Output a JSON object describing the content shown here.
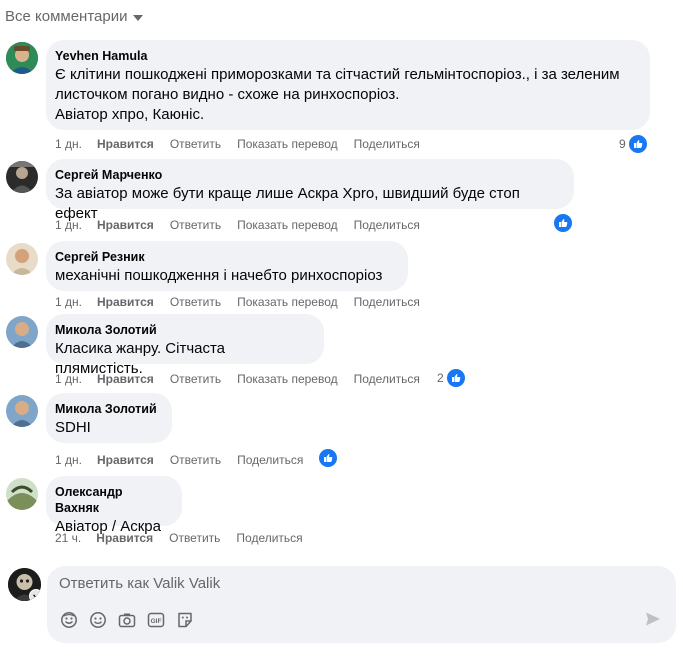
{
  "filter": {
    "label": "Все комментарии"
  },
  "comments": [
    {
      "author": "Yevhen Hamula",
      "lines": [
        "Є клітини пошкоджені приморозками та сітчастий гельмінтоспоріоз., і за зеленим",
        "листочком погано видно - схоже на ринхоспоріоз.",
        "Авіатор хпро, Каюніс."
      ],
      "time": "1 дн.",
      "like": "Нравится",
      "reply": "Ответить",
      "translate": "Показать перевод",
      "share": "Поделиться",
      "reactions": "9"
    },
    {
      "author": "Сергей Марченко",
      "lines": [
        "За авіатор може бути краще лише Аскра Xpro, швидший буде стоп ефект"
      ],
      "time": "1 дн.",
      "like": "Нравится",
      "reply": "Ответить",
      "translate": "Показать перевод",
      "share": "Поделиться",
      "reactions": ""
    },
    {
      "author": "Сергей Резник",
      "lines": [
        "механічні пошкодження і начебто ринхоспоріоз"
      ],
      "time": "1 дн.",
      "like": "Нравится",
      "reply": "Ответить",
      "translate": "Показать перевод",
      "share": "Поделиться"
    },
    {
      "author": "Микола Золотий",
      "lines": [
        "Класика жанру. Сітчаста плямистість."
      ],
      "time": "1 дн.",
      "like": "Нравится",
      "reply": "Ответить",
      "translate": "Показать перевод",
      "share": "Поделиться",
      "reactions": "2"
    },
    {
      "author": "Микола Золотий",
      "lines": [
        "SDHI"
      ],
      "time": "1 дн.",
      "like": "Нравится",
      "reply": "Ответить",
      "share": "Поделиться",
      "reactions": ""
    },
    {
      "author": "Олександр Вахняк",
      "lines": [
        "Авіатор / Аскра"
      ],
      "time": "21 ч.",
      "like": "Нравится",
      "reply": "Ответить",
      "share": "Поделиться"
    }
  ],
  "composer": {
    "placeholder": "Ответить как Valik Valik",
    "tools": [
      "emoji-icon",
      "smiley-icon",
      "camera-icon",
      "gif-icon",
      "sticker-icon"
    ],
    "send_icon": "send-icon"
  },
  "colors": {
    "like_blue": "#1877f2",
    "bubble": "#f0f2f5",
    "secondary_text": "#65676b"
  }
}
